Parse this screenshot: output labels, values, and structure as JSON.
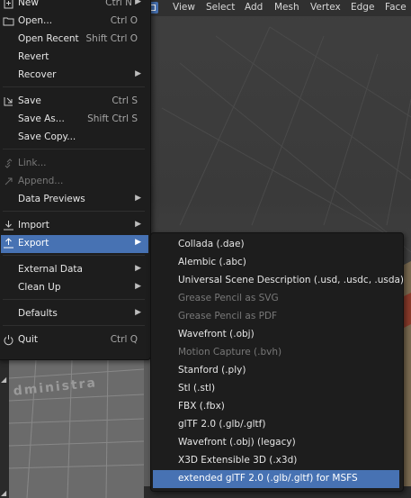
{
  "header": {
    "menus": [
      "View",
      "Select",
      "Add",
      "Mesh",
      "Vertex",
      "Edge",
      "Face"
    ]
  },
  "viewport": {
    "object_text": "dministra"
  },
  "file_menu": {
    "items": [
      {
        "label": "New",
        "shortcut": "Ctrl N",
        "submenu": true,
        "icon": "new-file-icon"
      },
      {
        "label": "Open...",
        "shortcut": "Ctrl O",
        "icon": "folder-icon"
      },
      {
        "label": "Open Recent",
        "shortcut": "Shift Ctrl O"
      },
      {
        "label": "Revert"
      },
      {
        "label": "Recover"
      },
      {
        "label": "Save",
        "shortcut": "Ctrl S",
        "icon": "save-icon"
      },
      {
        "label": "Save As...",
        "shortcut": "Shift Ctrl S"
      },
      {
        "label": "Save Copy..."
      },
      {
        "label": "Link...",
        "icon": "link-icon"
      },
      {
        "label": "Append...",
        "icon": "append-icon"
      },
      {
        "label": "Data Previews"
      },
      {
        "label": "Import",
        "icon": "import-icon"
      },
      {
        "label": "Export",
        "icon": "export-icon"
      },
      {
        "label": "External Data"
      },
      {
        "label": "Clean Up"
      },
      {
        "label": "Defaults"
      },
      {
        "label": "Quit",
        "shortcut": "Ctrl Q",
        "icon": "power-icon"
      }
    ]
  },
  "export_menu": {
    "items": [
      "Collada (.dae)",
      "Alembic (.abc)",
      "Universal Scene Description (.usd, .usdc, .usda)",
      "Grease Pencil as SVG",
      "Grease Pencil as PDF",
      "Wavefront (.obj)",
      "Motion Capture (.bvh)",
      "Stanford (.ply)",
      "Stl (.stl)",
      "FBX (.fbx)",
      "glTF 2.0 (.glb/.gltf)",
      "Wavefront (.obj) (legacy)",
      "X3D Extensible 3D (.x3d)",
      "extended glTF 2.0 (.glb/.gltf) for MSFS"
    ]
  },
  "colors": {
    "menu_bg": "#1d1d1d",
    "highlight": "#4772b3",
    "disabled_text": "#787878",
    "text": "#e6e6e6"
  }
}
